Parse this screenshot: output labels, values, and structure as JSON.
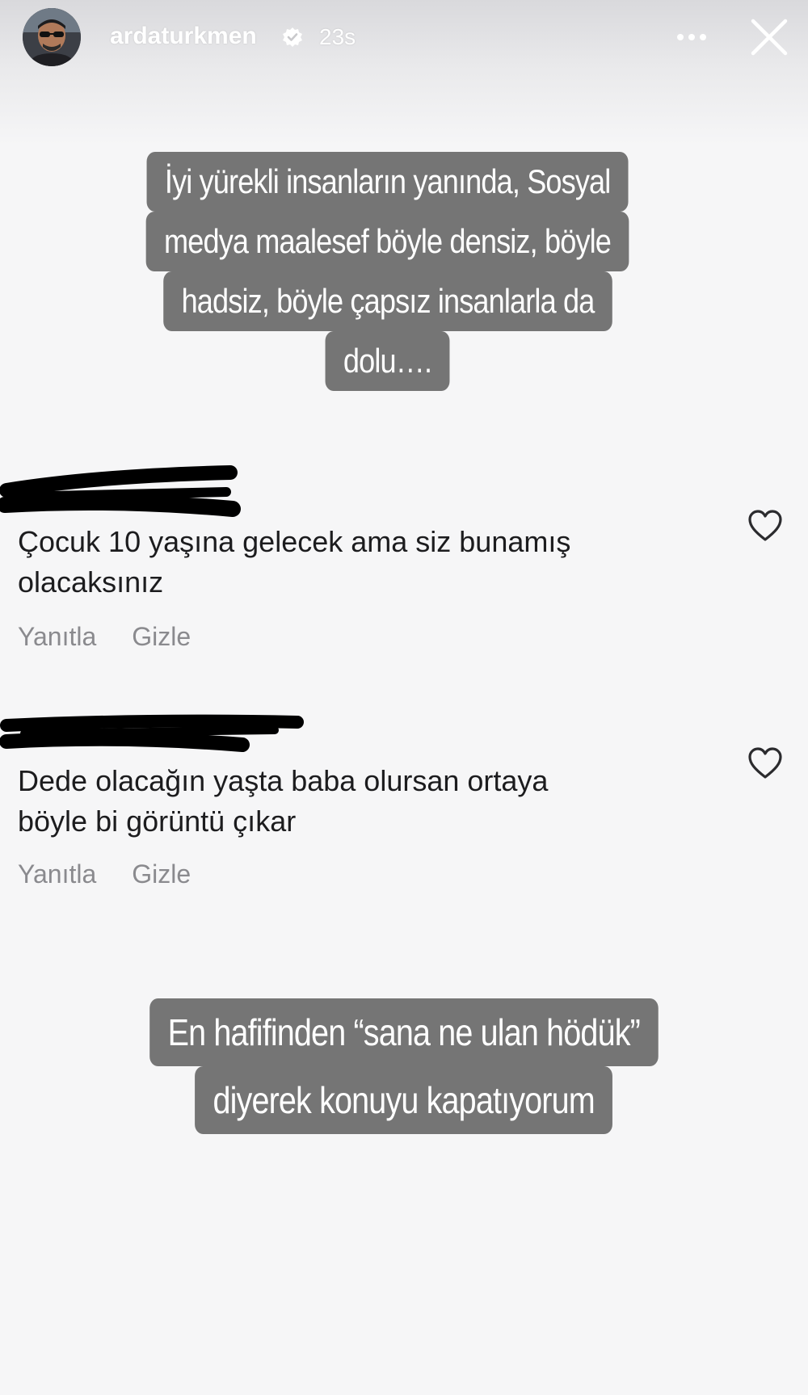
{
  "story": {
    "username": "ardaturkmen",
    "time": "23s",
    "caption_top": [
      "İyi yürekli insanların yanında, Sosyal",
      "medya maalesef böyle densiz, böyle",
      "hadsiz, böyle çapsız insanlarla da",
      "dolu…."
    ],
    "caption_bottom": [
      "En hafifinden “sana ne ulan hödük”",
      "diyerek konuyu kapatıyorum"
    ]
  },
  "comments": [
    {
      "text_line1": "Çocuk 10 yaşına gelecek ama siz bunamış",
      "text_line2": "olacaksınız",
      "reply": "Yanıtla",
      "hide": "Gizle"
    },
    {
      "text_line1": "Dede olacağın yaşta baba olursan ortaya",
      "text_line2": "böyle bi görüntü çıkar",
      "reply": "Yanıtla",
      "hide": "Gizle"
    }
  ],
  "icons": {
    "verified": "verified-badge-icon",
    "more": "more-options-icon",
    "close": "close-icon",
    "heart": "heart-outline-icon"
  },
  "colors": {
    "caption_bg": "#757575",
    "background": "#f6f6f7",
    "comment_text": "#1c1c1e",
    "action_text": "#8a8a8e"
  }
}
